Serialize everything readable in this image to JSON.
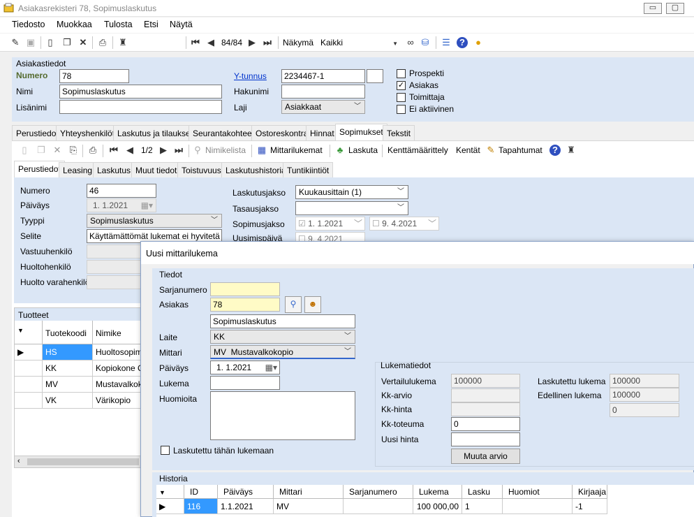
{
  "window": {
    "title": "Asiakasrekisteri 78, Sopimuslaskutus",
    "minimize": "▭",
    "maximize": "▢"
  },
  "menu": [
    "Tiedosto",
    "Muokkaa",
    "Tulosta",
    "Etsi",
    "Näytä"
  ],
  "toolbar": {
    "record_position": "84/84",
    "view_label": "Näkymä",
    "view_value": "Kaikki",
    "search_value": ""
  },
  "customer": {
    "group_title": "Asiakastiedot",
    "number_label": "Numero",
    "number_value": "78",
    "name_label": "Nimi",
    "name_value": "Sopimuslaskutus",
    "extra_label": "Lisänimi",
    "extra_value": "",
    "ytunnus_label": "Y-tunnus",
    "ytunnus_value": "2234467-1",
    "hakunimi_label": "Hakunimi",
    "hakunimi_value": "",
    "laji_label": "Laji",
    "laji_value": "Asiakkaat",
    "checks": [
      {
        "label": "Prospekti",
        "checked": false
      },
      {
        "label": "Asiakas",
        "checked": true
      },
      {
        "label": "Toimittaja",
        "checked": false
      },
      {
        "label": "Ei aktiivinen",
        "checked": false
      }
    ]
  },
  "main_tabs": [
    "Perustiedot",
    "Yhteyshenkilöt",
    "Laskutus ja tilaukset",
    "Seurantakohteet",
    "Ostoreskontra",
    "Hinnat",
    "Sopimukset",
    "Tekstit"
  ],
  "contract_toolbar": {
    "position": "1/2",
    "nimikelista": "Nimikelista",
    "mittarilukemat": "Mittarilukemat",
    "laskuta": "Laskuta",
    "kenttamaarittely": "Kenttämäärittely",
    "kentat": "Kentät",
    "tapahtumat": "Tapahtumat"
  },
  "sub_tabs": [
    "Perustiedot",
    "Leasing",
    "Laskutus",
    "Muut tiedot",
    "Toistuvuus",
    "Laskutushistoria",
    "Tuntikiintiöt"
  ],
  "contract": {
    "numero_label": "Numero",
    "numero_value": "46",
    "paivays_label": "Päiväys",
    "paivays_value": "1. 1.2021",
    "tyyppi_label": "Tyyppi",
    "tyyppi_value": "Sopimuslaskutus",
    "selite_label": "Selite",
    "selite_value": "Käyttämättömät lukemat ei hyvitetä",
    "vastuu_label": "Vastuuhenkilö",
    "huolto_label": "Huoltohenkilö",
    "huoltovara_label": "Huolto varahenkilö",
    "laskutusjakso_label": "Laskutusjakso",
    "laskutusjakso_value": "Kuukausittain (1)",
    "tasausjakso_label": "Tasausjakso",
    "tasausjakso_value": "",
    "sopimusjakso_label": "Sopimusjakso",
    "sopimus_start": "1. 1.2021",
    "sopimus_end": "9. 4.2021",
    "uusimis_label": "Uusimispäivä",
    "uusimis_value": "9. 4.2021"
  },
  "products": {
    "title": "Tuotteet",
    "columns": [
      "Tuotekoodi",
      "Nimike"
    ],
    "rows": [
      {
        "code": "HS",
        "name": "Huoltosopimus"
      },
      {
        "code": "KK",
        "name": "Kopiokone Ca"
      },
      {
        "code": "MV",
        "name": "Mustavalkoko"
      },
      {
        "code": "VK",
        "name": "Värikopio"
      }
    ]
  },
  "dialog": {
    "title": "Uusi mittarilukema",
    "tiedot_title": "Tiedot",
    "sarjanumero_label": "Sarjanumero",
    "sarjanumero_value": "",
    "asiakas_label": "Asiakas",
    "asiakas_value": "78",
    "asiakas_name": "Sopimuslaskutus",
    "laite_label": "Laite",
    "laite_value": "KK",
    "mittari_label": "Mittari",
    "mittari_value": "MV  Mustavalkokopio",
    "paivays_label": "Päiväys",
    "paivays_value": "1. 1.2021",
    "lukema_label": "Lukema",
    "lukema_value": "",
    "huomioita_label": "Huomioita",
    "huomioita_value": "",
    "laskutettu_label": "Laskutettu tähän lukemaan",
    "lukematiedot_title": "Lukematiedot",
    "vertailu_label": "Vertailulukema",
    "vertailu_value": "100000",
    "kkarvio_label": "Kk-arvio",
    "kkarvio_value": "",
    "kkhinta_label": "Kk-hinta",
    "kkhinta_value": "",
    "kktoteuma_label": "Kk-toteuma",
    "kktoteuma_value": "0",
    "uusihinta_label": "Uusi hinta",
    "uusihinta_value": "",
    "muuta_button": "Muuta arvio",
    "laskutettu_lukema_label": "Laskutettu lukema",
    "laskutettu_lukema_value": "100000",
    "edellinen_label": "Edellinen lukema",
    "edellinen_value": "100000",
    "extra_value": "0",
    "historia_title": "Historia",
    "hist_columns": [
      "ID",
      "Päiväys",
      "Mittari",
      "Sarjanumero",
      "Lukema",
      "Lasku",
      "Huomiot",
      "Kirjaaja"
    ],
    "hist_rows": [
      {
        "id": "116",
        "date": "1.1.2021",
        "meter": "MV",
        "serial": "",
        "reading": "100 000,00",
        "invoice": "1",
        "notes": "",
        "by": "-1"
      }
    ]
  }
}
